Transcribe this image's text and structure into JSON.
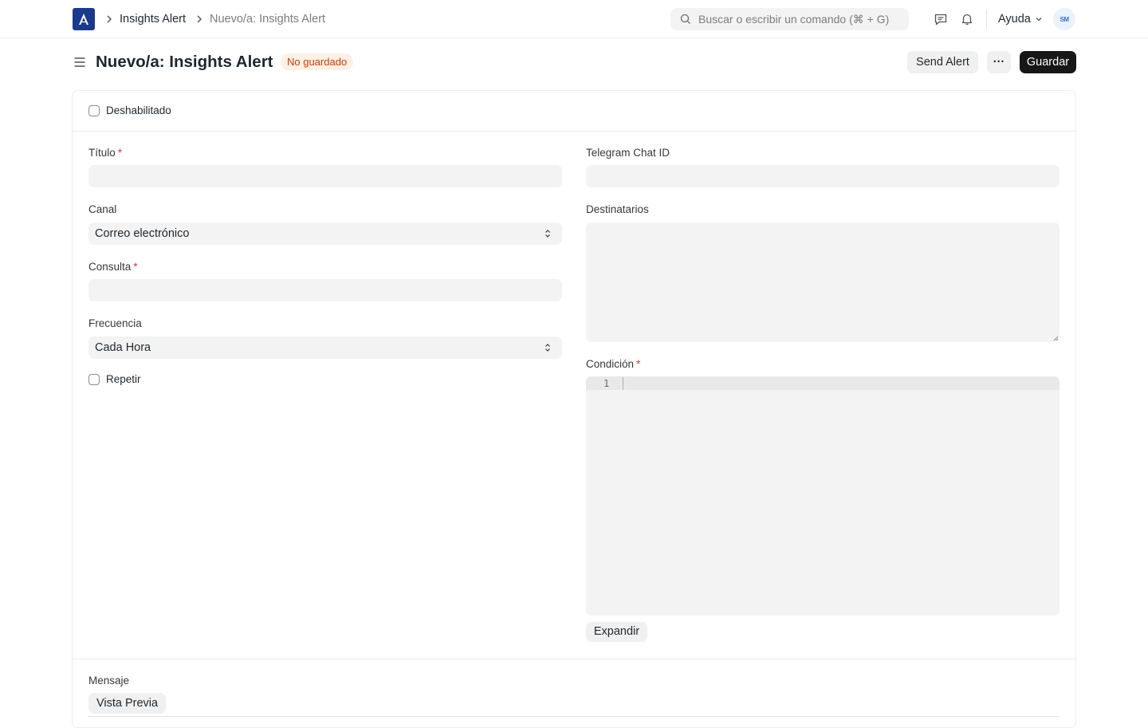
{
  "navbar": {
    "breadcrumbs": [
      "Insights Alert",
      "Nuevo/a: Insights Alert"
    ],
    "search_placeholder": "Buscar o escribir un comando (⌘ + G)",
    "help_label": "Ayuda",
    "avatar_initials": "SM"
  },
  "page": {
    "title": "Nuevo/a: Insights Alert",
    "status_badge": "No guardado",
    "actions": {
      "send_alert": "Send Alert",
      "more": "···",
      "save": "Guardar"
    }
  },
  "form": {
    "disabled_label": "Deshabilitado",
    "title_label": "Título",
    "title_value": "",
    "channel_label": "Canal",
    "channel_value": "Correo electrónico",
    "query_label": "Consulta",
    "query_value": "",
    "frequency_label": "Frecuencia",
    "frequency_value": "Cada Hora",
    "repeat_label": "Repetir",
    "telegram_label": "Telegram Chat ID",
    "telegram_value": "",
    "recipients_label": "Destinatarios",
    "recipients_value": "",
    "condition_label": "Condición",
    "condition_line_number": "1",
    "expand_label": "Expandir",
    "message_label": "Mensaje",
    "preview_label": "Vista Previa"
  },
  "colors": {
    "logo": "#1c3a8a",
    "badge_bg": "#fff0e6",
    "badge_text": "#c2410c",
    "primary_button": "#171717",
    "required_star": "#e03636"
  }
}
